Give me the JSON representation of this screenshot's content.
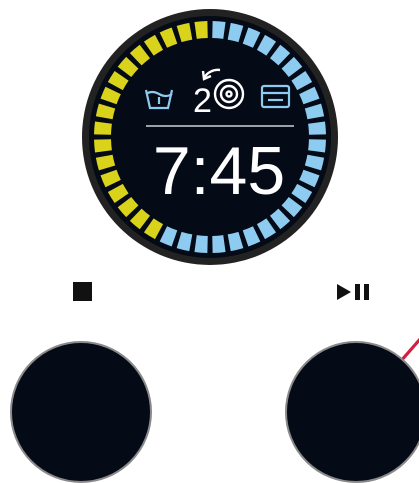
{
  "display": {
    "time": "7:45",
    "program_number": "2",
    "colors": {
      "face": "#050a17",
      "bezel": "#222222",
      "progress_done": "#d9d31c",
      "progress_remaining": "#8ecbf0",
      "divider": "#9aa0a6",
      "icon": "#8ecbf0",
      "text": "#ffffff"
    },
    "progress": {
      "total_segments": 40,
      "completed_segments": 18
    },
    "icons": [
      "wash-basin-icon",
      "program-cycle-icon",
      "dryer-icon"
    ]
  },
  "controls": {
    "stop_label_icon": "stop-icon",
    "play_pause_label_icon": "play-pause-icon",
    "accent_arrow_color": "#d42040"
  }
}
